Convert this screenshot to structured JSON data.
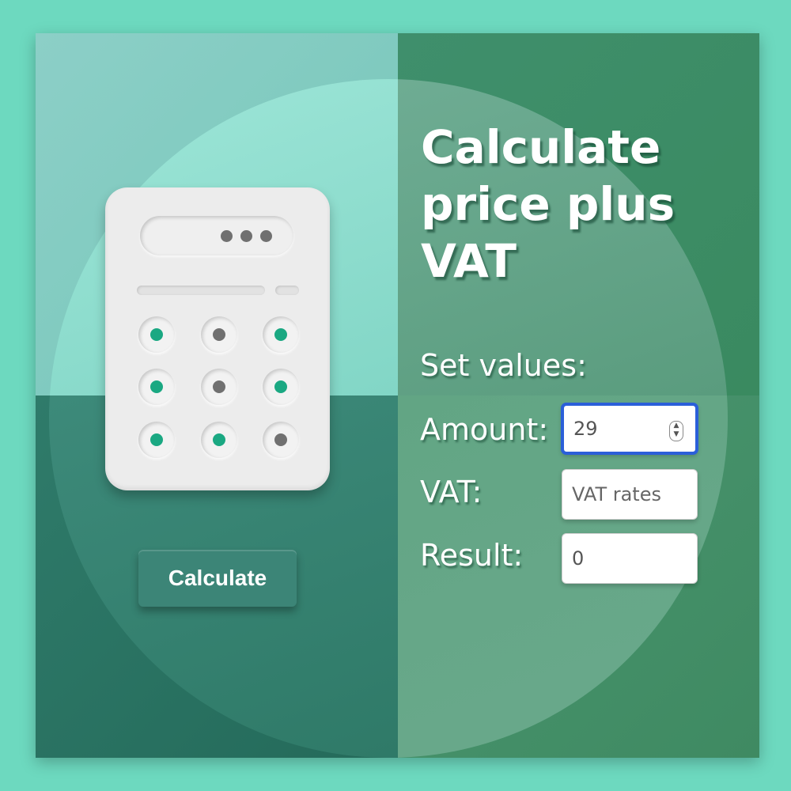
{
  "header": {
    "title_line1": "Calculate",
    "title_line2": "price plus",
    "title_line3": "VAT"
  },
  "form": {
    "section_label": "Set values:",
    "amount_label": "Amount:",
    "amount_value": "29",
    "vat_label": "VAT:",
    "vat_placeholder": "VAT rates",
    "result_label": "Result:",
    "result_value": "0"
  },
  "actions": {
    "calculate_label": "Calculate"
  },
  "illustration": {
    "icon": "calculator-icon",
    "key_colors": [
      "#1aa882",
      "#707070"
    ]
  },
  "colors": {
    "background": "#6dd9bf",
    "accent_focus": "#2b5fd9",
    "button": "#3c8577"
  }
}
